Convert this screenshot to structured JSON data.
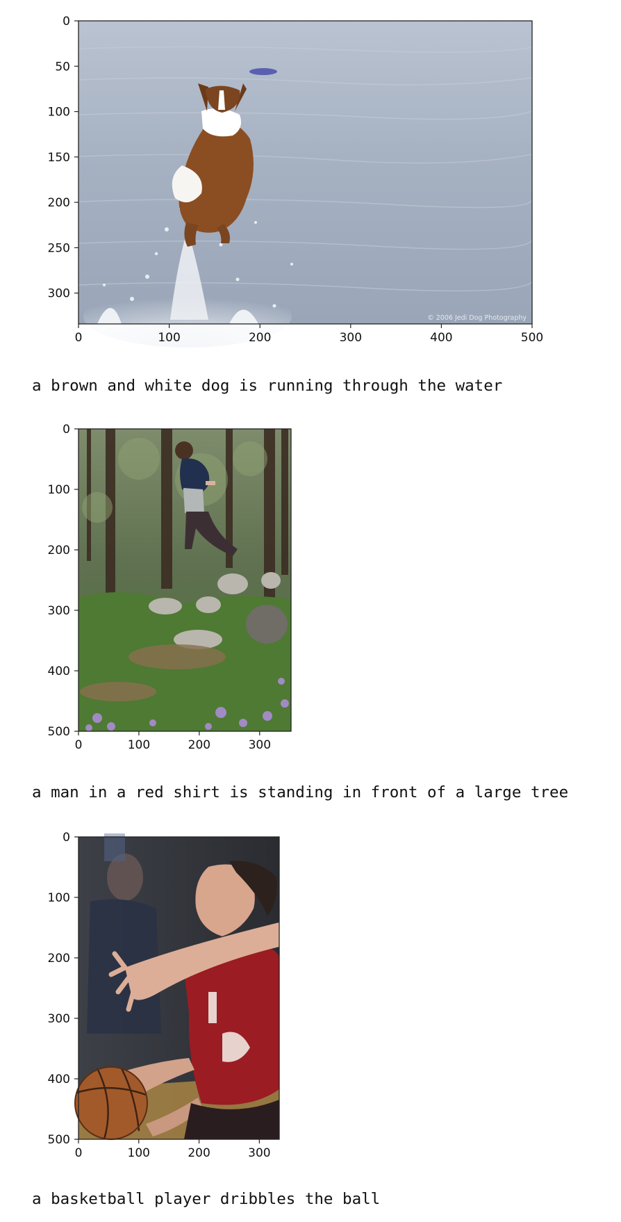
{
  "figures": [
    {
      "image_subject": "dog jumping over water",
      "image_size": [
        500,
        334
      ],
      "x_ticks": [
        "0",
        "100",
        "200",
        "300",
        "400",
        "500"
      ],
      "y_ticks": [
        "0",
        "50",
        "100",
        "150",
        "200",
        "250",
        "300"
      ],
      "watermark": "© 2006 Jedi Dog Photography",
      "caption": "a brown and white dog is running through the water"
    },
    {
      "image_subject": "boy jumping among trees and rocks",
      "image_size": [
        352,
        500
      ],
      "x_ticks": [
        "0",
        "100",
        "200",
        "300"
      ],
      "y_ticks": [
        "0",
        "100",
        "200",
        "300",
        "400",
        "500"
      ],
      "caption": "a man in a red shirt is standing in front of a large tree"
    },
    {
      "image_subject": "basketball player going up with ball",
      "image_size": [
        333,
        500
      ],
      "x_ticks": [
        "0",
        "100",
        "200",
        "300"
      ],
      "y_ticks": [
        "0",
        "100",
        "200",
        "300",
        "400",
        "500"
      ],
      "caption": "a basketball player dribbles the ball"
    }
  ]
}
